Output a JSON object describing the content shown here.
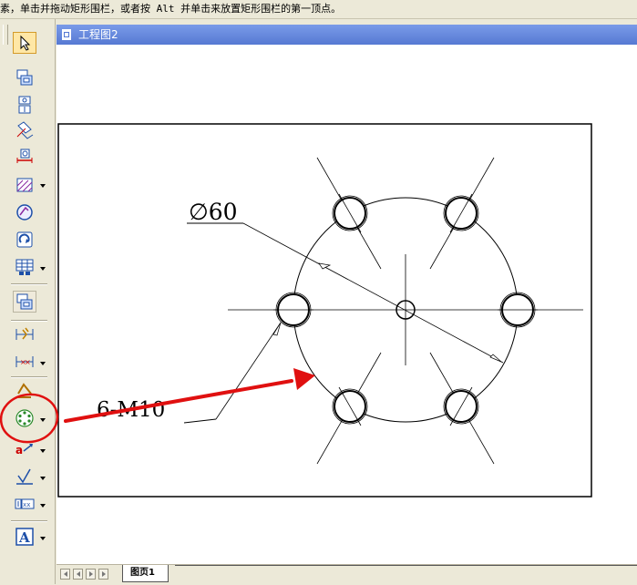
{
  "status_bar": {
    "text": "素，单击并拖动矩形围栏，或者按 Alt 并单击来放置矩形围栏的第一顶点。"
  },
  "document": {
    "title": "工程图2"
  },
  "drawing": {
    "diameter_label": "∅60",
    "hole_label": "6-M10"
  },
  "sheet_tabs": [
    {
      "label": "图页1"
    }
  ],
  "toolbar": {
    "tools": [
      {
        "name": "select-tool",
        "icon": "select-arrow-icon"
      },
      {
        "name": "model-view-tool",
        "icon": "model-view-icon"
      },
      {
        "name": "projected-view-tool",
        "icon": "projected-view-icon"
      },
      {
        "name": "auxiliary-view-tool",
        "icon": "auxiliary-view-icon"
      },
      {
        "name": "section-view-tool",
        "icon": "section-view-icon"
      },
      {
        "name": "hatch-tool",
        "icon": "hatch-icon"
      },
      {
        "name": "detail-view-tool",
        "icon": "detail-view-icon"
      },
      {
        "name": "rotate-view-tool",
        "icon": "rotate-view-icon"
      },
      {
        "name": "table-tool",
        "icon": "table-icon"
      },
      {
        "name": "view-tool",
        "icon": "view-icon"
      },
      {
        "name": "smart-dimension-tool",
        "icon": "smart-dimension-icon"
      },
      {
        "name": "linear-dimension-tool",
        "icon": "linear-dimension-icon"
      },
      {
        "name": "center-mark-tool",
        "icon": "center-mark-icon"
      },
      {
        "name": "bolt-circle-tool",
        "icon": "bolt-circle-icon"
      },
      {
        "name": "leader-note-tool",
        "icon": "leader-note-icon"
      },
      {
        "name": "surface-finish-tool",
        "icon": "surface-finish-icon"
      },
      {
        "name": "weld-symbol-tool",
        "icon": "weld-symbol-icon"
      },
      {
        "name": "text-tool",
        "icon": "text-icon"
      }
    ]
  },
  "colors": {
    "title_bar": "#5679d3",
    "annotation": "#e01010",
    "selected_tool": "#ffe7a6"
  }
}
